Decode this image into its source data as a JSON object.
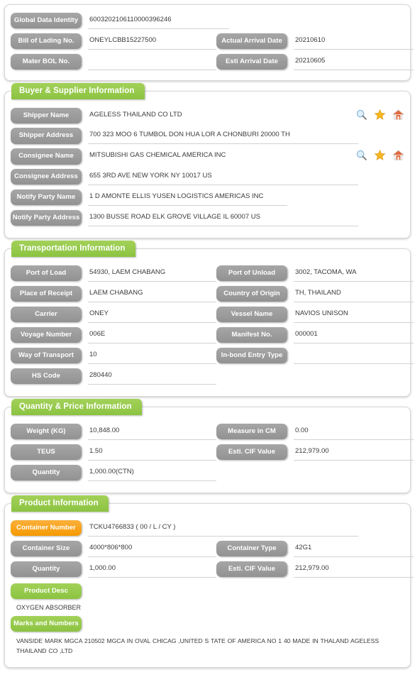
{
  "header_section": {
    "fields": [
      {
        "label": "Global Data Identity",
        "value": "6003202106110000396246",
        "full": true
      },
      {
        "label": "Bill of Lading No.",
        "value": "ONEYLCBB15227500"
      },
      {
        "label": "Actual Arrival Date",
        "value": "20210610"
      },
      {
        "label": "Mater BOL No.",
        "value": ""
      },
      {
        "label": "Esti Arrival Date",
        "value": "20210605"
      }
    ]
  },
  "buyer_supplier": {
    "title": "Buyer & Supplier Information",
    "fields": [
      {
        "label": "Shipper Name",
        "value": "AGELESS THAILAND CO LTD",
        "icons": true
      },
      {
        "label": "Shipper Address",
        "value": "700 323 MOO 6 TUMBOL DON HUA LOR A CHONBURI 20000 TH",
        "icons": false
      },
      {
        "label": "Consignee Name",
        "value": "MITSUBISHI GAS CHEMICAL AMERICA INC",
        "icons": true
      },
      {
        "label": "Consignee Address",
        "value": "655 3RD AVE NEW YORK NY 10017 US",
        "icons": false
      },
      {
        "label": "Notify Party Name",
        "value": "1 D AMONTE ELLIS YUSEN LOGISTICS AMERICAS INC",
        "icons": false
      },
      {
        "label": "Notify Party Address",
        "value": "1300 BUSSE ROAD ELK GROVE VILLAGE IL 60007 US",
        "icons": false
      }
    ],
    "icon_names": [
      "search-icon",
      "star-icon",
      "home-icon"
    ]
  },
  "transportation": {
    "title": "Transportation Information",
    "rows": [
      {
        "left": {
          "label": "Port of Load",
          "value": "54930, LAEM CHABANG"
        },
        "right": {
          "label": "Port of Unload",
          "value": "3002, TACOMA, WA"
        }
      },
      {
        "left": {
          "label": "Place of Receipt",
          "value": "LAEM CHABANG"
        },
        "right": {
          "label": "Country of Origin",
          "value": "TH, THAILAND"
        }
      },
      {
        "left": {
          "label": "Carrier",
          "value": "ONEY"
        },
        "right": {
          "label": "Vessel Name",
          "value": "NAVIOS UNISON"
        }
      },
      {
        "left": {
          "label": "Voyage Number",
          "value": "006E"
        },
        "right": {
          "label": "Manifest No.",
          "value": "000001"
        }
      },
      {
        "left": {
          "label": "Way of Transport",
          "value": "10"
        },
        "right": {
          "label": "In-bond Entry Type",
          "value": ""
        }
      },
      {
        "left": {
          "label": "HS Code",
          "value": "280440"
        },
        "right": null
      }
    ]
  },
  "quantity_price": {
    "title": "Quantity & Price Information",
    "rows": [
      {
        "left": {
          "label": "Weight (KG)",
          "value": "10,848.00"
        },
        "right": {
          "label": "Measure in CM",
          "value": "0.00"
        }
      },
      {
        "left": {
          "label": "TEUS",
          "value": "1.50"
        },
        "right": {
          "label": "Esti. CIF Value",
          "value": "212,979.00"
        }
      },
      {
        "left": {
          "label": "Quantity",
          "value": "1,000.00(CTN)"
        },
        "right": null
      }
    ]
  },
  "product": {
    "title": "Product Information",
    "container_number": {
      "label": "Container Number",
      "value": "TCKU4766833 ( 00 / L / CY )"
    },
    "rows": [
      {
        "left": {
          "label": "Container Size",
          "value": "4000*806*800"
        },
        "right": {
          "label": "Container Type",
          "value": "42G1"
        }
      },
      {
        "left": {
          "label": "Quantity",
          "value": "1,000.00"
        },
        "right": {
          "label": "Esti. CIF Value",
          "value": "212,979.00"
        }
      }
    ],
    "product_desc": {
      "label": "Product Desc",
      "value": "OXYGEN ABSORBER"
    },
    "marks": {
      "label": "Marks and Numbers",
      "value": "VANSIDE MARK MGCA 210502 MGCA IN OVAL CHICAG ,UNITED S TATE OF AMERICA NO 1 40 MADE IN THALAND AGELESS THAILAND CO ,LTD"
    }
  },
  "colors": {
    "green": "#96ca4f",
    "orange": "#f6a318",
    "gray": "#9b9b9b",
    "star": "#f5a623",
    "home": "#e0653a",
    "search": "#7fb2d9"
  }
}
